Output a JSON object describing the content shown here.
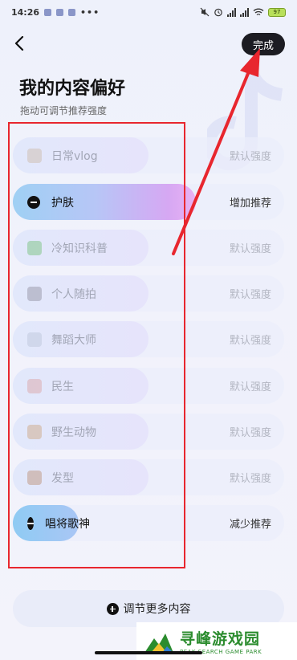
{
  "status_bar": {
    "time": "14:26",
    "dots": "•••",
    "battery": "97"
  },
  "header": {
    "done_label": "完成",
    "title": "我的内容偏好",
    "subtitle": "拖动可调节推荐强度"
  },
  "preferences": [
    {
      "label": "日常vlog",
      "strength": "默认强度",
      "state": "default",
      "icon": "vlog-icon"
    },
    {
      "label": "护肤",
      "strength": "增加推荐",
      "state": "increase",
      "icon": "minus-icon"
    },
    {
      "label": "冷知识科普",
      "strength": "默认强度",
      "state": "default",
      "icon": "book-icon"
    },
    {
      "label": "个人随拍",
      "strength": "默认强度",
      "state": "default",
      "icon": "camera-person-icon"
    },
    {
      "label": "舞蹈大师",
      "strength": "默认强度",
      "state": "default",
      "icon": "dance-icon"
    },
    {
      "label": "民生",
      "strength": "默认强度",
      "state": "default",
      "icon": "house-icon"
    },
    {
      "label": "野生动物",
      "strength": "默认强度",
      "state": "default",
      "icon": "animal-icon"
    },
    {
      "label": "发型",
      "strength": "默认强度",
      "state": "default",
      "icon": "hair-icon"
    },
    {
      "label": "唱将歌神",
      "strength": "减少推荐",
      "state": "decrease",
      "icon": "minus-icon"
    }
  ],
  "more_button": {
    "label": "调节更多内容"
  },
  "watermark": {
    "cn": "寻峰游戏园",
    "en": "PEAK SEARCH GAME PARK"
  },
  "colors": {
    "annotation_red": "#e8262e",
    "done_button_bg": "#1c1c22"
  }
}
